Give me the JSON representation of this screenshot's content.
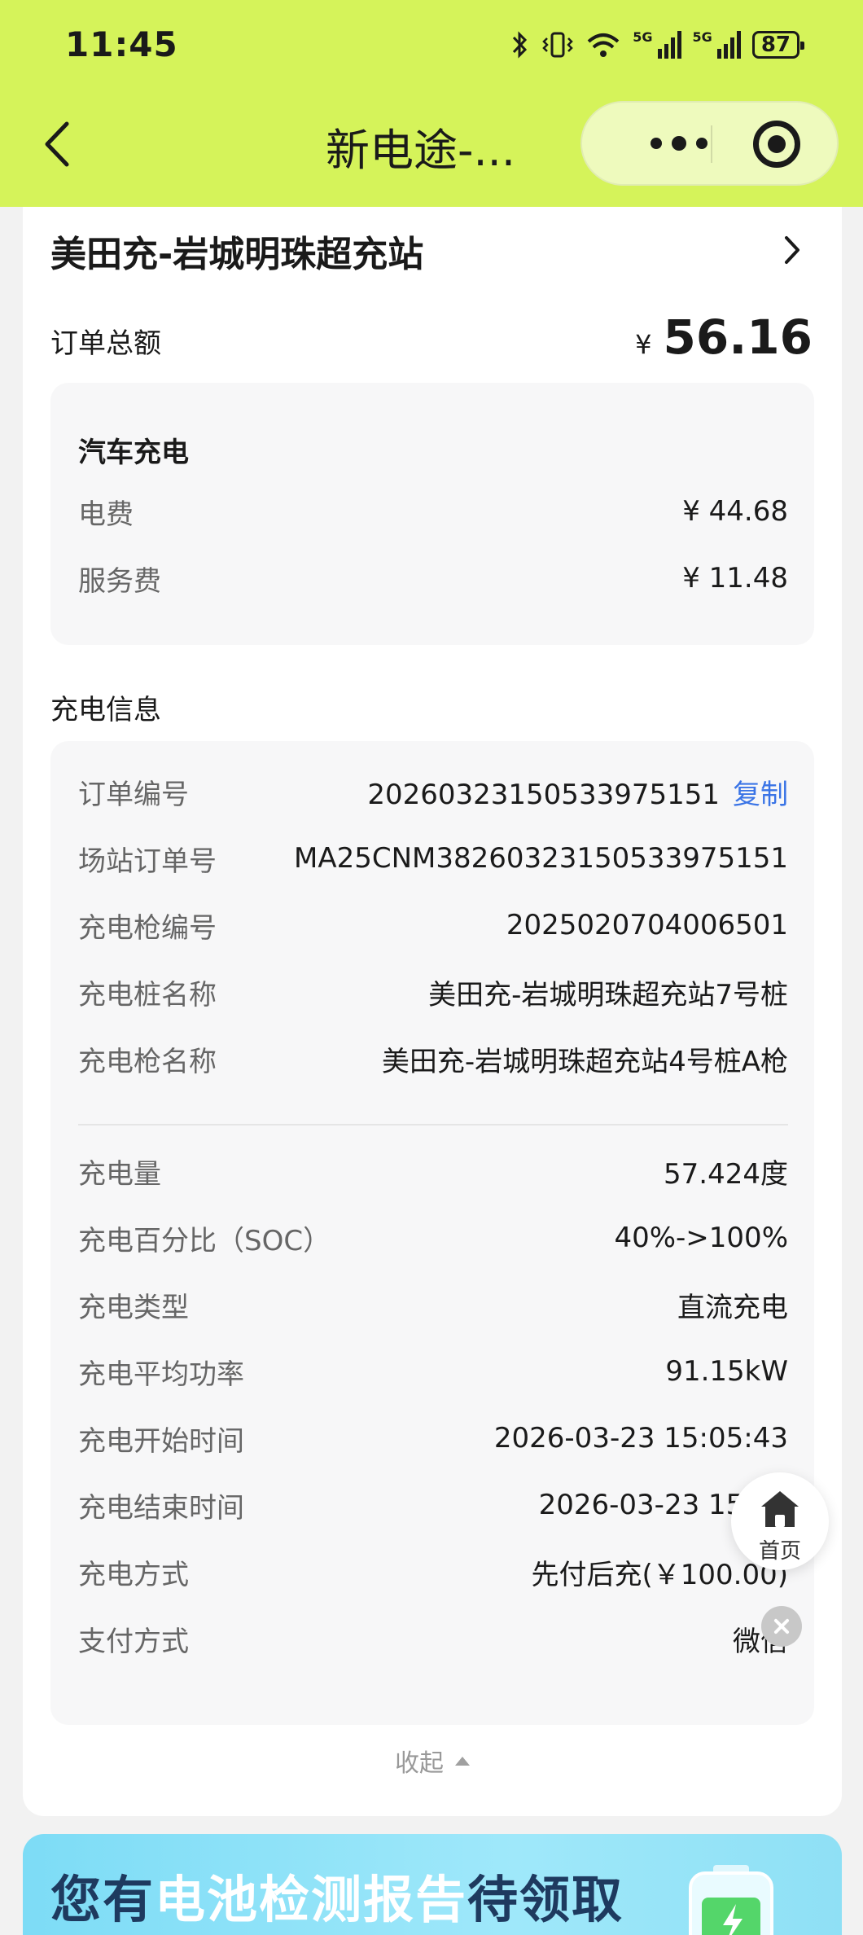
{
  "status_bar": {
    "time": "11:45",
    "network_label": "5G",
    "battery_level": "87"
  },
  "nav": {
    "title": "新电途-..."
  },
  "order": {
    "station_name": "美田充-岩城明珠超充站",
    "total_label": "订单总额",
    "currency": "¥",
    "total_amount": "56.16",
    "fee_section": {
      "title": "汽车充电",
      "rows": [
        {
          "label": "电费",
          "value": "¥ 44.68"
        },
        {
          "label": "服务费",
          "value": "¥ 11.48"
        }
      ]
    }
  },
  "charge_info": {
    "title": "充电信息",
    "copy_label": "复制",
    "rows_top": [
      {
        "label": "订单编号",
        "value": "20260323150533975151"
      },
      {
        "label": "场站订单号",
        "value": "MA25CNM38260323150533975151"
      },
      {
        "label": "充电枪编号",
        "value": "2025020704006501"
      },
      {
        "label": "充电桩名称",
        "value": "美田充-岩城明珠超充站7号桩"
      },
      {
        "label": "充电枪名称",
        "value": "美田充-岩城明珠超充站4号桩A枪"
      }
    ],
    "rows_bottom": [
      {
        "label": "充电量",
        "value": "57.424度"
      },
      {
        "label": "充电百分比（SOC）",
        "value": "40%->100%"
      },
      {
        "label": "充电类型",
        "value": "直流充电"
      },
      {
        "label": "充电平均功率",
        "value": "91.15kW"
      },
      {
        "label": "充电开始时间",
        "value": "2026-03-23 15:05:43"
      },
      {
        "label": "充电结束时间",
        "value": "2026-03-23 15:43"
      },
      {
        "label": "充电方式",
        "value": "先付后充(￥100.00)"
      },
      {
        "label": "支付方式",
        "value": "微信"
      }
    ],
    "collapse_label": "收起"
  },
  "floating": {
    "home_label": "首页"
  },
  "banner": {
    "text_part1": "您有",
    "text_part2": "电池检测报告",
    "text_part3": "待领取"
  },
  "colors": {
    "header_bg": "#d5f35a",
    "link_blue": "#3a74e6",
    "banner_bg": "#8fe0f5"
  }
}
